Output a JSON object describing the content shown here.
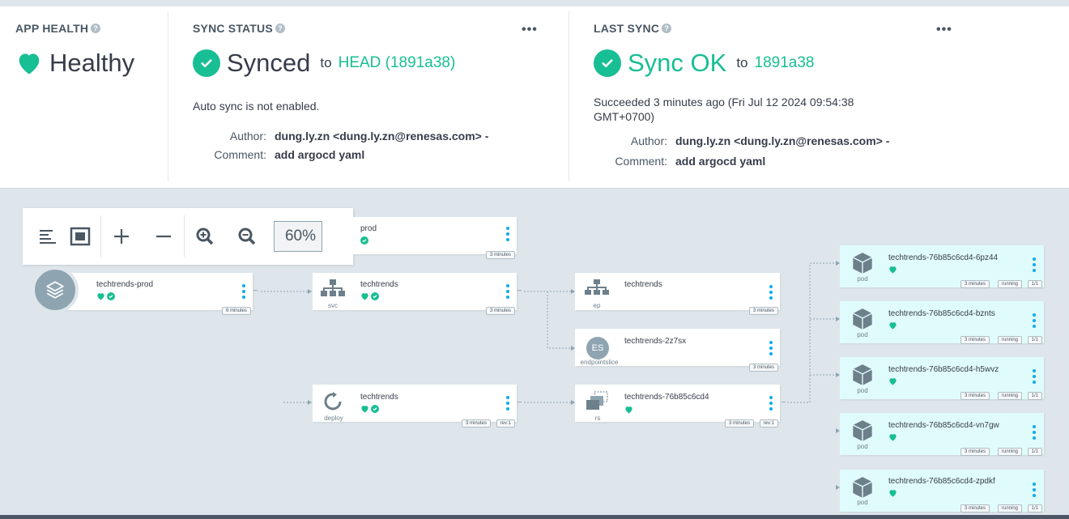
{
  "app_health": {
    "title": "APP HEALTH",
    "status": "Healthy"
  },
  "sync_status": {
    "title": "SYNC STATUS",
    "status": "Synced",
    "to": "to",
    "revision": "HEAD (1891a38)",
    "auto_sync": "Auto sync is not enabled.",
    "author_label": "Author:",
    "author": "dung.ly.zn <dung.ly.zn@renesas.com> -",
    "comment_label": "Comment:",
    "comment": "add argocd yaml"
  },
  "last_sync": {
    "title": "LAST SYNC",
    "status": "Sync OK",
    "to": "to",
    "revision": "1891a38",
    "succeeded_line1": "Succeeded 3 minutes ago (Fri Jul 12 2024 09:54:38",
    "succeeded_line2": "GMT+0700)",
    "author_label": "Author:",
    "author": "dung.ly.zn <dung.ly.zn@renesas.com> -",
    "comment_label": "Comment:",
    "comment": "add argocd yaml"
  },
  "toolbar": {
    "zoom": "60%"
  },
  "graph": {
    "app": {
      "name": "techtrends-prod",
      "age": "6 minutes"
    },
    "namespace": {
      "name": "prod",
      "age": "3 minutes"
    },
    "svc": {
      "name": "techtrends",
      "kind": "svc",
      "age": "3 minutes"
    },
    "deploy": {
      "name": "techtrends",
      "kind": "deploy",
      "age": "3 minutes",
      "rev": "rev:1"
    },
    "ep": {
      "name": "techtrends",
      "kind": "ep",
      "age": "3 minutes"
    },
    "endpointslice": {
      "name": "techtrends-2z7sx",
      "kind": "endpointslice",
      "badge": "ES",
      "age": "3 minutes"
    },
    "rs": {
      "name": "techtrends-76b85c6cd4",
      "kind": "rs",
      "age": "3 minutes",
      "rev": "rev:1"
    },
    "pods": [
      {
        "name": "techtrends-76b85c6cd4-6pz44",
        "kind": "pod",
        "age": "3 minutes",
        "state": "running",
        "ready": "1/1"
      },
      {
        "name": "techtrends-76b85c6cd4-bznts",
        "kind": "pod",
        "age": "3 minutes",
        "state": "running",
        "ready": "1/1"
      },
      {
        "name": "techtrends-76b85c6cd4-h5wvz",
        "kind": "pod",
        "age": "3 minutes",
        "state": "running",
        "ready": "1/1"
      },
      {
        "name": "techtrends-76b85c6cd4-vn7gw",
        "kind": "pod",
        "age": "3 minutes",
        "state": "running",
        "ready": "1/1"
      },
      {
        "name": "techtrends-76b85c6cd4-zpdkf",
        "kind": "pod",
        "age": "3 minutes",
        "state": "running",
        "ready": "1/1"
      }
    ]
  },
  "colors": {
    "healthy": "#18be94",
    "accent": "#0dadea",
    "text": "#363c4a",
    "background": "#dee6eb"
  }
}
